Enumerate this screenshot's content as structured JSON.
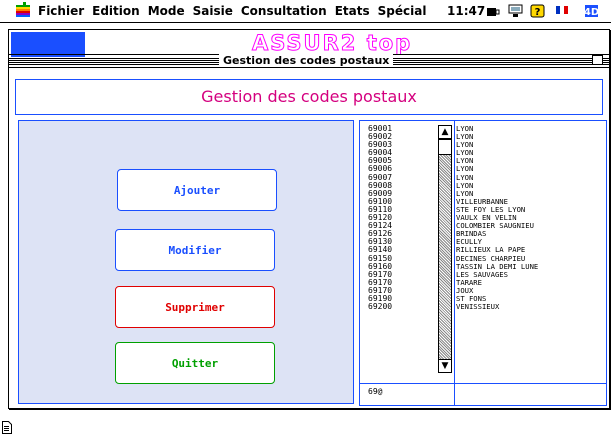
{
  "menubar": {
    "items": [
      "Fichier",
      "Edition",
      "Mode",
      "Saisie",
      "Consultation",
      "Etats",
      "Spécial"
    ],
    "clock": "11:47",
    "icons": [
      "apple-icon",
      "coffee-cup-icon",
      "network-icon",
      "help-icon",
      "flag-icon",
      "app-switch-icon"
    ]
  },
  "window": {
    "app_title": "ASSUR2 top",
    "title": "Gestion des codes postaux",
    "header": "Gestion des codes postaux"
  },
  "buttons": {
    "ajouter": "Ajouter",
    "modifier": "Modifier",
    "supprimer": "Supprimer",
    "quitter": "Quitter"
  },
  "list": {
    "rows": [
      {
        "code": "69001",
        "city": "LYON"
      },
      {
        "code": "69002",
        "city": "LYON"
      },
      {
        "code": "69003",
        "city": "LYON"
      },
      {
        "code": "69004",
        "city": "LYON"
      },
      {
        "code": "69005",
        "city": "LYON"
      },
      {
        "code": "69006",
        "city": "LYON"
      },
      {
        "code": "69007",
        "city": "LYON"
      },
      {
        "code": "69008",
        "city": "LYON"
      },
      {
        "code": "69009",
        "city": "LYON"
      },
      {
        "code": "69100",
        "city": "VILLEURBANNE"
      },
      {
        "code": "69110",
        "city": "STE FOY LES LYON"
      },
      {
        "code": "69120",
        "city": "VAULX EN VELIN"
      },
      {
        "code": "69124",
        "city": "COLOMBIER SAUGNIEU"
      },
      {
        "code": "69126",
        "city": "BRINDAS"
      },
      {
        "code": "69130",
        "city": "ECULLY"
      },
      {
        "code": "69140",
        "city": "RILLIEUX LA PAPE"
      },
      {
        "code": "69150",
        "city": "DECINES CHARPIEU"
      },
      {
        "code": "69160",
        "city": "TASSIN LA DEMI LUNE"
      },
      {
        "code": "69170",
        "city": "LES SAUVAGES"
      },
      {
        "code": "69170",
        "city": "TARARE"
      },
      {
        "code": "69170",
        "city": "JOUX"
      },
      {
        "code": "69190",
        "city": "ST FONS"
      },
      {
        "code": "69200",
        "city": "VENISSIEUX"
      }
    ],
    "search_value": "69@"
  },
  "colors": {
    "accent": "#1a4fff",
    "title_magenta": "#d4007f",
    "delete_red": "#e00000",
    "quit_green": "#00a000"
  }
}
